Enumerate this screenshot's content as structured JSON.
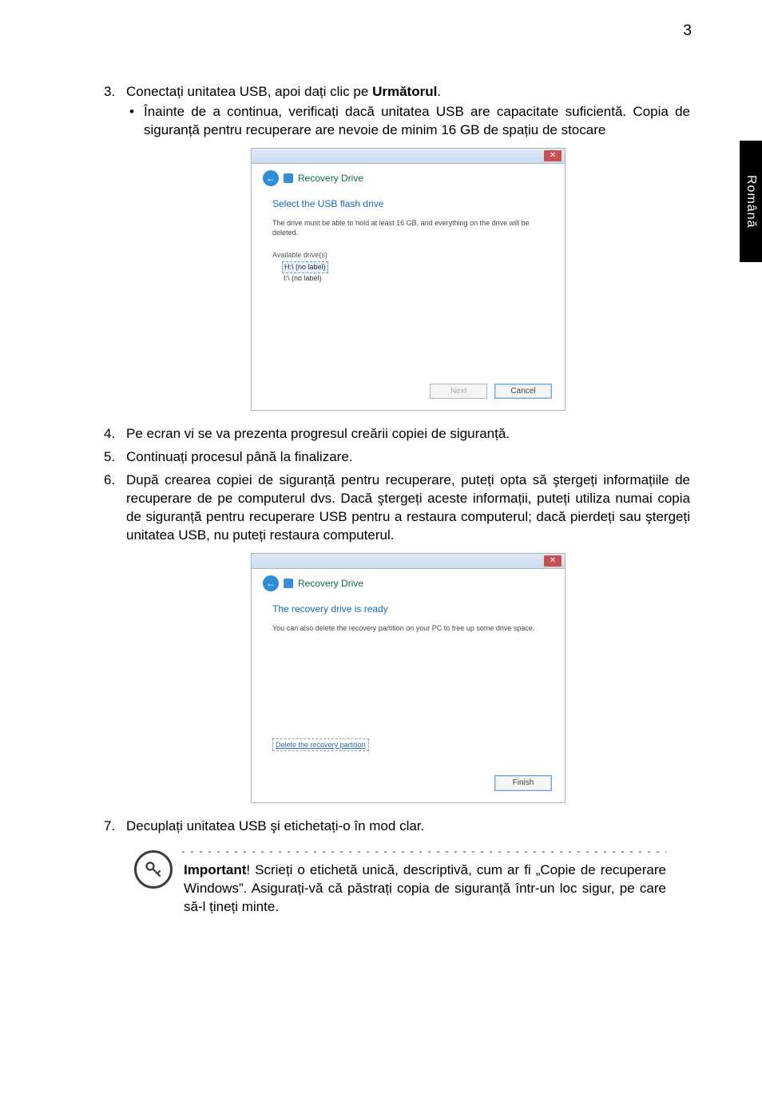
{
  "page_number": "3",
  "side_tab": "Română",
  "list": {
    "item3": {
      "text_before_bold": "Conectați unitatea USB, apoi dați clic pe ",
      "bold": "Următorul",
      "text_after_bold": ".",
      "bullet": "Înainte de a continua, verificați dacă unitatea USB are capacitate suficientă. Copia de siguranță pentru recuperare are nevoie de minim 16 GB de spațiu de stocare"
    },
    "item4": "Pe ecran vi se va prezenta progresul creării copiei de siguranță.",
    "item5": "Continuați procesul până la finalizare.",
    "item6": "După crearea copiei de siguranță pentru recuperare, puteți opta să ştergeți informațiile de recuperare de pe computerul dvs. Dacă ştergeți aceste informații, puteți utiliza numai copia de siguranță pentru recuperare USB pentru a restaura computerul; dacă pierdeți sau ştergeți unitatea USB, nu puteți restaura computerul.",
    "item7": "Decuplați unitatea USB şi etichetați-o în mod clar."
  },
  "dialog1": {
    "title": "Recovery Drive",
    "step_title": "Select the USB flash drive",
    "note": "The drive must be able to hold at least 16 GB, and everything on the drive will be deleted.",
    "section_label": "Available drive(s)",
    "drive_selected": "H:\\ (no label)",
    "drive_other": "I:\\ (no label)",
    "btn_next": "Next",
    "btn_cancel": "Cancel"
  },
  "dialog2": {
    "title": "Recovery Drive",
    "step_title": "The recovery drive is ready",
    "note": "You can also delete the recovery partition on your PC to free up some drive space.",
    "link": "Delete the recovery partition",
    "btn_finish": "Finish"
  },
  "callout": {
    "bold": "Important",
    "text": "! Scrieți o etichetă unică, descriptivă, cum ar fi „Copie de recuperare Windows”. Asigurați-vă că păstrați copia de siguranță într-un loc sigur, pe care să-l țineți minte."
  }
}
